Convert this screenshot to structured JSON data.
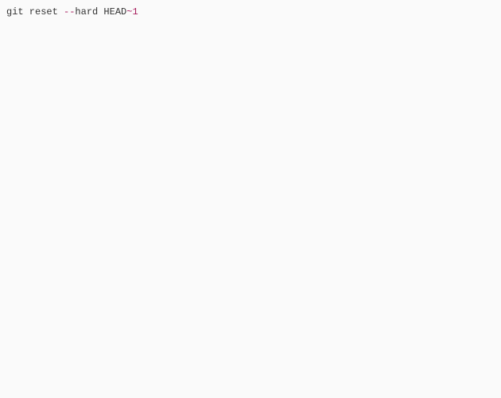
{
  "code": {
    "cmd": "git reset ",
    "dashes": "--",
    "flag": "hard HEAD",
    "tilde": "~",
    "num": "1"
  }
}
